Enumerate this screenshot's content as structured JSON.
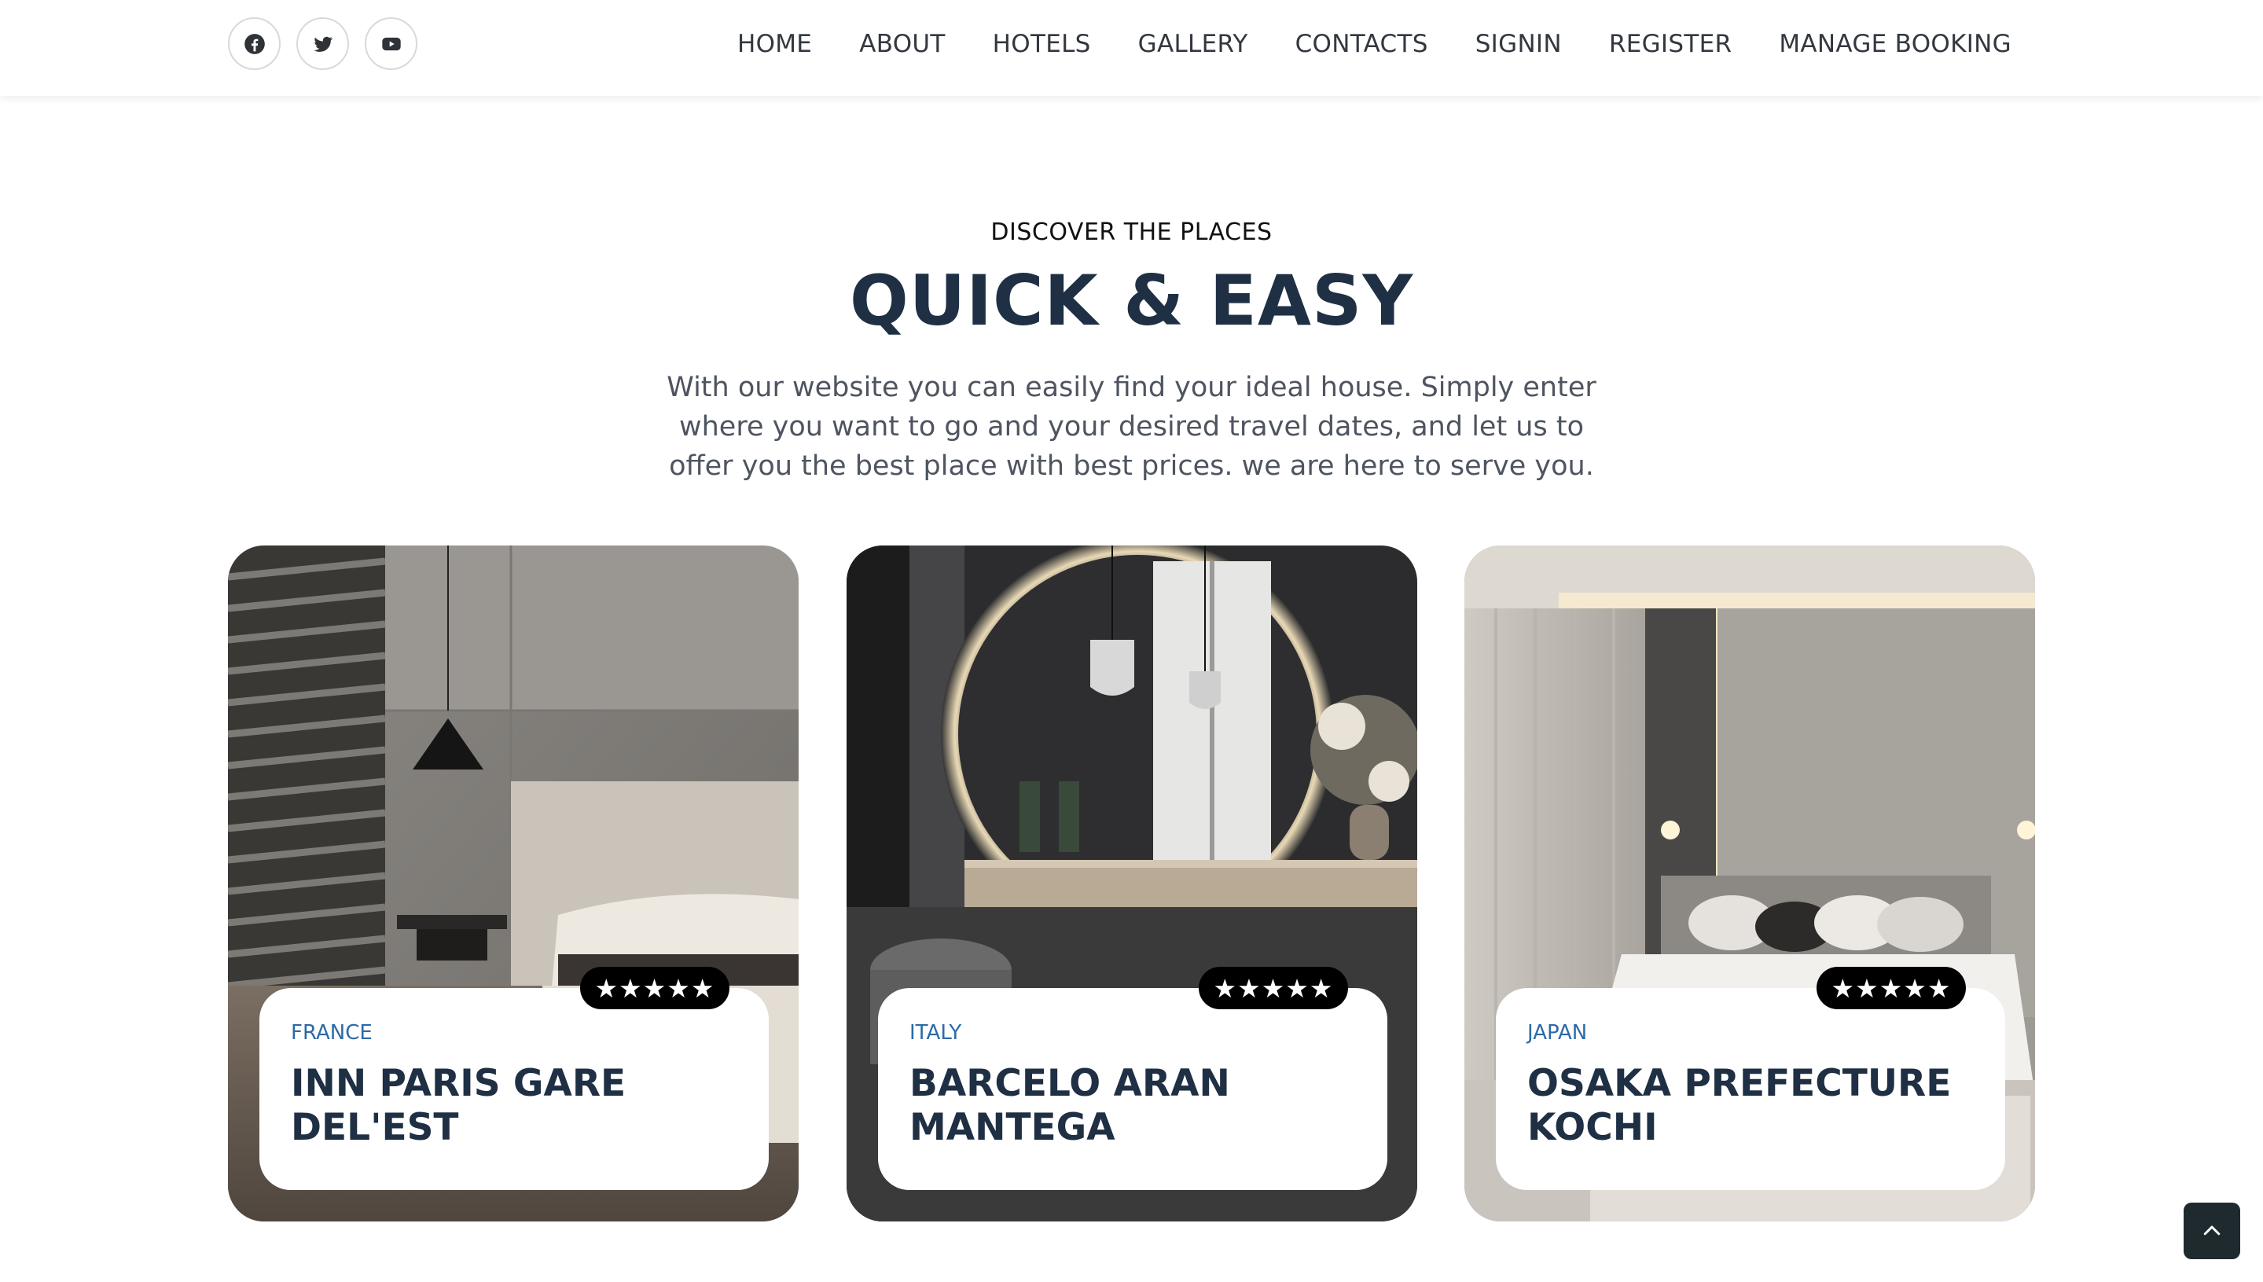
{
  "header": {
    "socials": [
      {
        "icon": "facebook-icon"
      },
      {
        "icon": "twitter-icon"
      },
      {
        "icon": "youtube-icon"
      }
    ],
    "nav": [
      "HOME",
      "ABOUT",
      "HOTELS",
      "GALLERY",
      "CONTACTS",
      "SIGNIN",
      "REGISTER",
      "MANAGE BOOKING"
    ]
  },
  "intro": {
    "eyebrow": "DISCOVER THE PLACES",
    "headline": "QUICK & EASY",
    "lead": "With our website you can easily find your ideal house. Simply enter where you want to go and your desired travel dates, and let us to offer you the best place with best prices. we are here to serve you."
  },
  "cards": [
    {
      "country": "FRANCE",
      "name": "INN PARIS GARE DEL'EST",
      "rating": "★★★★★"
    },
    {
      "country": "ITALY",
      "name": "BARCELO ARAN MANTEGA",
      "rating": "★★★★★"
    },
    {
      "country": "JAPAN",
      "name": "OSAKA PREFECTURE KOCHI",
      "rating": "★★★★★"
    }
  ],
  "colors": {
    "heading": "#1f2f44",
    "accent": "#2b6aa8",
    "body_text": "#4e5560",
    "badge_bg": "#000000",
    "back_top_bg": "#1f2a2e"
  },
  "back_to_top": {
    "icon": "chevron-up-icon"
  }
}
